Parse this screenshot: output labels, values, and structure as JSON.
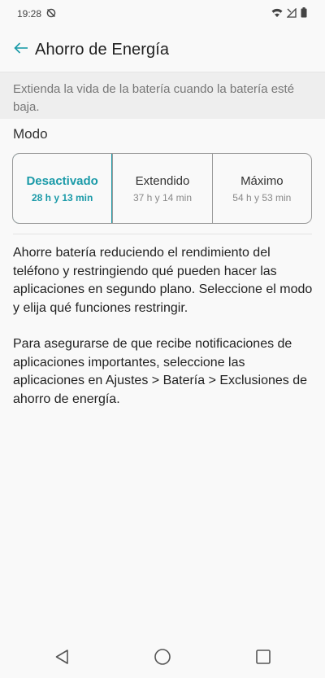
{
  "status_bar": {
    "time": "19:28",
    "left_icons": [
      "do-not-disturb-off-icon"
    ],
    "right_icons": [
      "wifi-icon",
      "signal-icon",
      "battery-icon"
    ]
  },
  "app_bar": {
    "title": "Ahorro de Energía",
    "back_icon": "arrow-left-icon"
  },
  "banner": {
    "text": "Extienda la vida de la batería cuando la batería esté baja."
  },
  "mode_section": {
    "label": "Modo",
    "options": [
      {
        "name": "Desactivado",
        "time": "28 h y 13 min",
        "selected": true
      },
      {
        "name": "Extendido",
        "time": "37 h y 14 min",
        "selected": false
      },
      {
        "name": "Máximo",
        "time": "54 h y 53 min",
        "selected": false
      }
    ]
  },
  "description": {
    "paragraph1": "Ahorre batería reduciendo el rendimiento del teléfono y restringiendo qué pueden hacer las aplicaciones en segundo plano. Seleccione el modo y elija qué funciones restringir.",
    "paragraph2": "Para asegurarse de que recibe notificaciones de aplicaciones importantes, seleccione las aplicaciones en Ajustes > Batería > Exclusiones de ahorro de energía."
  },
  "nav_bar": {
    "icons": [
      "back-triangle-icon",
      "home-circle-icon",
      "recents-square-icon"
    ]
  },
  "colors": {
    "accent": "#1a9aa8",
    "background": "#f9f9f9",
    "banner_bg": "#eeeeee"
  }
}
